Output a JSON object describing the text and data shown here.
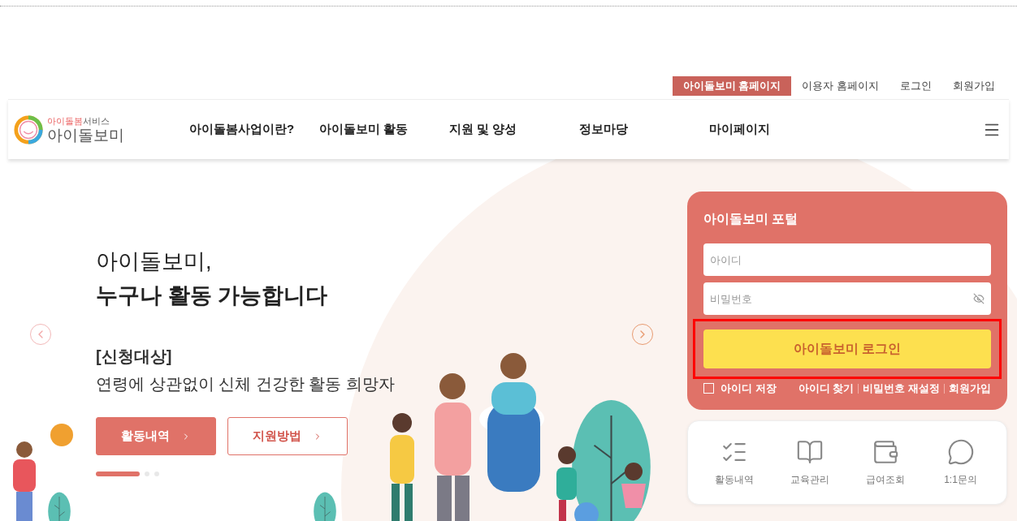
{
  "utility_links": [
    {
      "label": "아이돌보미 홈페이지",
      "selected": true
    },
    {
      "label": "이용자 홈페이지",
      "selected": false
    },
    {
      "label": "로그인",
      "selected": false
    },
    {
      "label": "회원가입",
      "selected": false
    }
  ],
  "logo": {
    "top": "아이돌봄",
    "top_suffix": "서비스",
    "name": "아이돌보미"
  },
  "nav": [
    "아이돌봄사업이란?",
    "아이돌보미 활동",
    "지원 및 양성",
    "정보마당",
    "마이페이지"
  ],
  "hero": {
    "headline": "아이돌보미,",
    "headline_bold": "누구나 활동 가능합니다",
    "label": "[신청대상]",
    "description": "연령에 상관없이 신체 건강한 활동 희망자",
    "buttons": [
      {
        "label": "활동내역",
        "kind": "filled"
      },
      {
        "label": "지원방법",
        "kind": "outline"
      }
    ],
    "slides": [
      {
        "selected": true
      },
      {
        "selected": false
      },
      {
        "selected": false
      }
    ]
  },
  "login": {
    "title": "아이돌보미 포털",
    "id_placeholder": "아이디",
    "password_placeholder": "비밀번호",
    "button": "아이돌보미 로그인",
    "button_highlighted": true,
    "remember": {
      "label": "아이디 저장",
      "checked": false
    },
    "links": [
      "아이디 찾기",
      "비밀번호 재설정",
      "회원가입"
    ]
  },
  "quick_links": [
    {
      "label": "활동내역",
      "kind": "checklist"
    },
    {
      "label": "교육관리",
      "kind": "book"
    },
    {
      "label": "급여조회",
      "kind": "wallet"
    },
    {
      "label": "1:1문의",
      "kind": "qna"
    }
  ]
}
